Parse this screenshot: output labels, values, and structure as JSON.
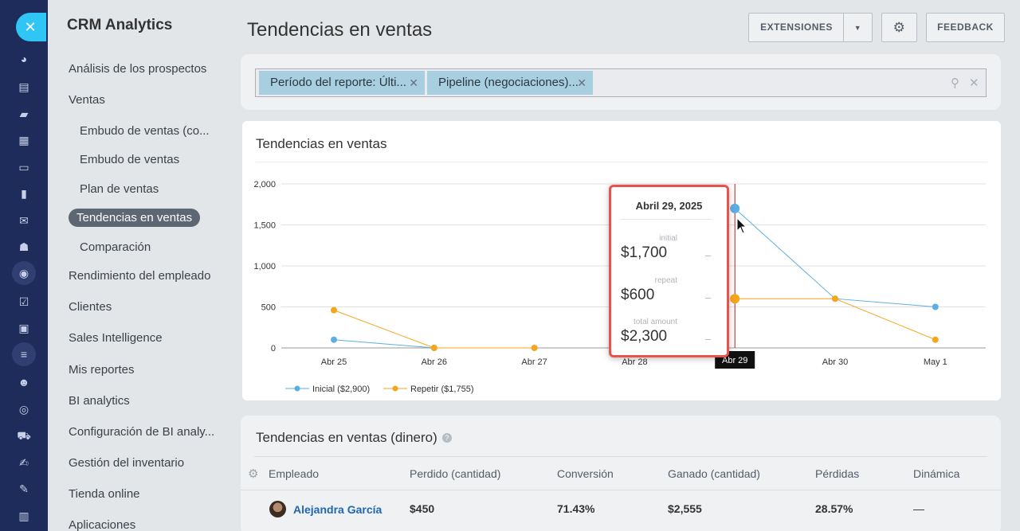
{
  "app": {
    "title": "CRM Analytics"
  },
  "sidebar": {
    "items": [
      {
        "label": "Análisis de los prospectos"
      },
      {
        "label": "Ventas"
      },
      {
        "label": "Embudo de ventas (co..."
      },
      {
        "label": "Embudo de ventas"
      },
      {
        "label": "Plan de ventas"
      },
      {
        "label": "Tendencias en ventas"
      },
      {
        "label": "Comparación"
      },
      {
        "label": "Rendimiento del empleado"
      },
      {
        "label": "Clientes"
      },
      {
        "label": "Sales Intelligence"
      },
      {
        "label": "Mis reportes"
      },
      {
        "label": "BI analytics"
      },
      {
        "label": "Configuración de BI analy..."
      },
      {
        "label": "Gestión del inventario"
      },
      {
        "label": "Tienda online"
      },
      {
        "label": "Aplicaciones"
      }
    ]
  },
  "header": {
    "title": "Tendencias en ventas",
    "extensions_label": "EXTENSIONES",
    "feedback_label": "FEEDBACK"
  },
  "filters": {
    "chips": [
      {
        "label": "Período del reporte: Últi..."
      },
      {
        "label": "Pipeline (negociaciones)..."
      }
    ]
  },
  "chart_card": {
    "title": "Tendencias en ventas"
  },
  "chart_data": {
    "type": "line",
    "title": "Tendencias en ventas",
    "categories": [
      "Abr 25",
      "Abr 26",
      "Abr 27",
      "Abr 28",
      "Abr 29",
      "Abr 30",
      "May 1"
    ],
    "series": [
      {
        "name": "Inicial ($2,900)",
        "color": "#5eaee2",
        "values": [
          100,
          0,
          null,
          null,
          1700,
          600,
          500
        ]
      },
      {
        "name": "Repetir ($1,755)",
        "color": "#f7a51b",
        "values": [
          460,
          0,
          0,
          null,
          600,
          600,
          100
        ]
      }
    ],
    "yticks": [
      "0",
      "500",
      "1,000",
      "1,500",
      "2,000"
    ],
    "ylim": [
      0,
      2000
    ],
    "grid": true,
    "legend": "bottom-left",
    "hover_category": "Abr 29"
  },
  "tooltip": {
    "title": "Abril 29, 2025",
    "rows": [
      {
        "label": "initial",
        "value": "$1,700",
        "trend": "–"
      },
      {
        "label": "repeat",
        "value": "$600",
        "trend": "–"
      },
      {
        "label": "total amount",
        "value": "$2,300",
        "trend": "–"
      }
    ]
  },
  "table": {
    "title": "Tendencias en ventas (dinero)",
    "columns": [
      "Empleado",
      "Perdido (cantidad)",
      "Conversión",
      "Ganado (cantidad)",
      "Pérdidas",
      "Dinámica"
    ],
    "rows": [
      {
        "employee": "Alejandra García",
        "lost": "$450",
        "conversion": "71.43%",
        "won": "$2,555",
        "losses": "28.57%",
        "dynamics": "—"
      }
    ]
  },
  "colors": {
    "accent": "#2fc6f6",
    "rail": "#1d2c5a",
    "highlight": "#e8534b"
  }
}
